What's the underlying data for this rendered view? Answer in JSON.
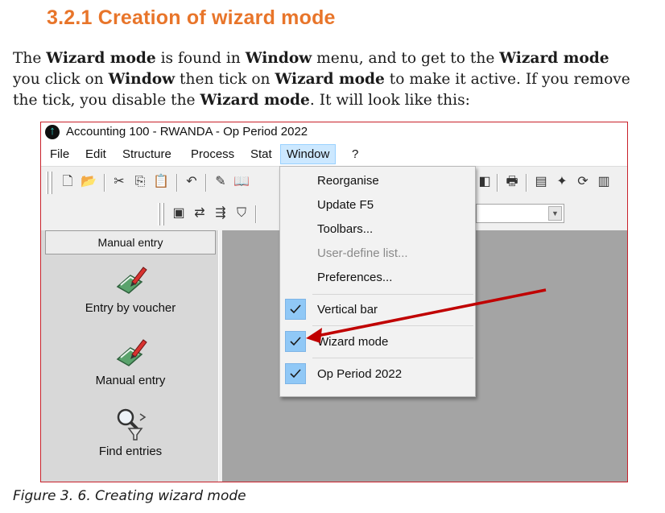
{
  "heading": "3.2.1 Creation of wizard mode",
  "paragraph": {
    "t1": "The ",
    "b1": "Wizard mode",
    "t2": " is found in ",
    "b2": "Window",
    "t3": " menu, and to get to the ",
    "b3": "Wizard mode",
    "t4": " you click on ",
    "b4": "Window",
    "t5": " then tick on ",
    "b5": "Wizard mode",
    "t6": " to make it active. If you remove the tick, you disable the ",
    "b6": "Wizard mode",
    "t7": ". It will look like this:"
  },
  "window": {
    "title": "Accounting 100 - RWANDA - Op Period 2022",
    "menus": [
      "File",
      "Edit",
      "Structure",
      "Process",
      "Stat",
      "Window",
      "?"
    ],
    "active_menu": "Window"
  },
  "dropdown": {
    "items": [
      "Reorganise",
      "Update F5",
      "Toolbars...",
      "User-define list...",
      "Preferences..."
    ],
    "checked_items": [
      "Vertical bar",
      "Wizard mode",
      "Op Period 2022"
    ]
  },
  "sidepanel": {
    "header": "Manual entry",
    "entries": [
      "Entry by voucher",
      "Manual entry",
      "Find entries"
    ]
  },
  "caption": "Figure 3. 6. Creating wizard mode",
  "colors": {
    "heading": "#e8752a",
    "arrow": "#c00000",
    "frame": "#c8202a",
    "check_bg": "#90c8f6"
  }
}
